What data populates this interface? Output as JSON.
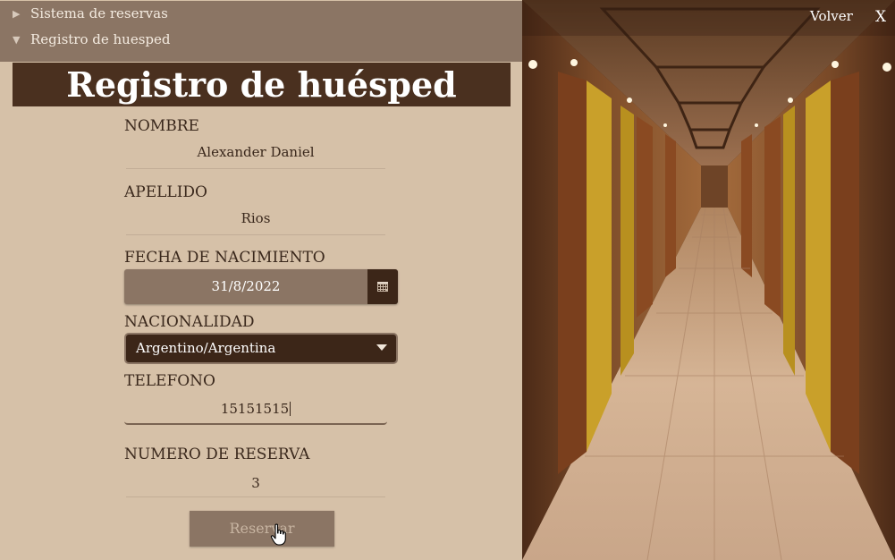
{
  "accordion": {
    "item1": "Sistema de reservas",
    "item2": "Registro de huesped"
  },
  "form": {
    "title": "Registro de huésped",
    "nombre_label": "NOMBRE",
    "nombre_value": "Alexander Daniel",
    "apellido_label": "APELLIDO",
    "apellido_value": "Rios",
    "fecha_label": "FECHA DE NACIMIENTO",
    "fecha_value": "31/8/2022",
    "nacionalidad_label": "NACIONALIDAD",
    "nacionalidad_value": "Argentino/Argentina",
    "telefono_label": "TELEFONO",
    "telefono_value": "15151515",
    "reserva_label": "NUMERO DE RESERVA",
    "reserva_value": "3",
    "submit_label": "Reservar"
  },
  "topbar": {
    "volver": "Volver",
    "close": "X"
  },
  "icons": {
    "collapsed": "triangle-right-icon",
    "expanded": "triangle-down-icon",
    "calendar": "calendar-icon",
    "dropdown": "chevron-down-icon",
    "cursor": "hand-cursor-icon"
  },
  "colors": {
    "panel_bg": "#d6c1a8",
    "title_bg": "#4a301f",
    "accordion_bg": "#8b7564",
    "select_bg": "#3c2618"
  }
}
